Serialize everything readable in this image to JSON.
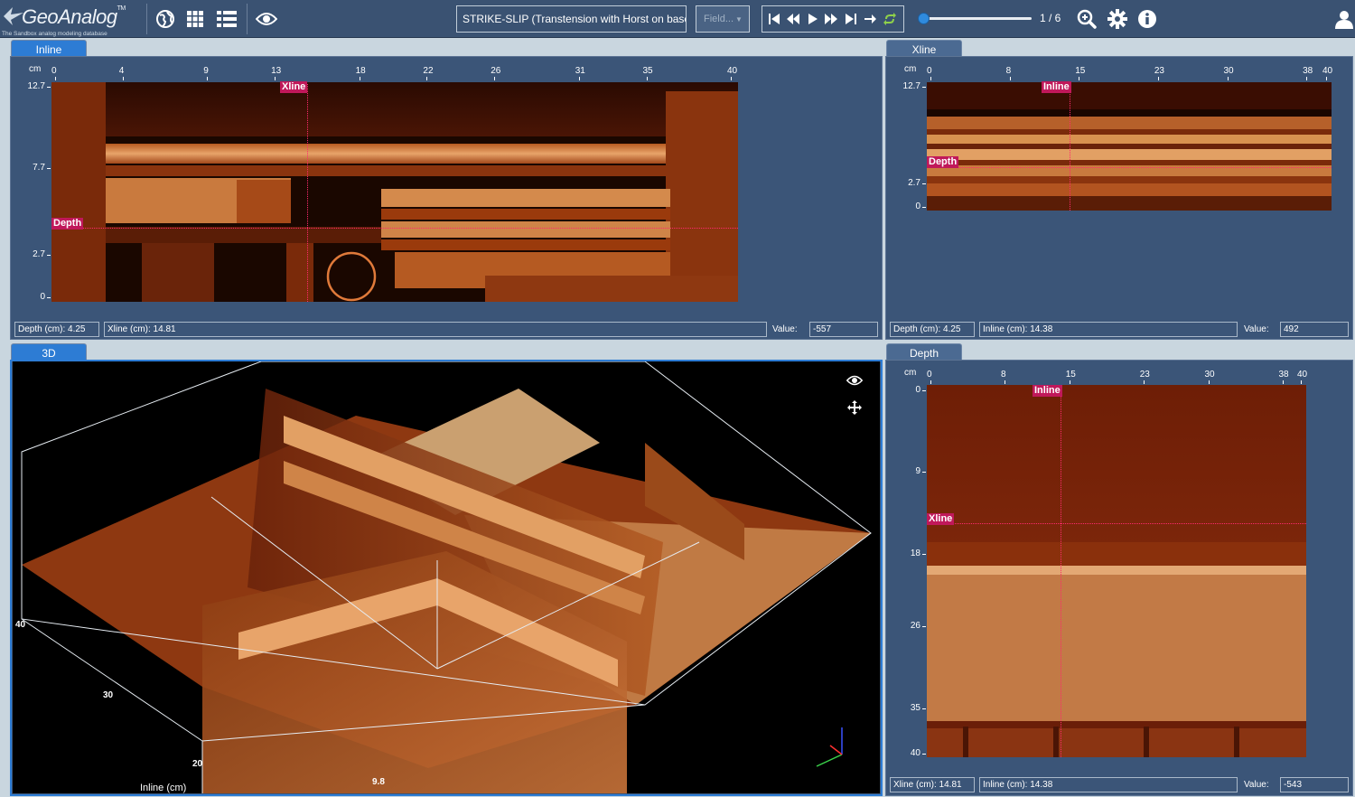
{
  "app": {
    "logo_text": "GeoAnalog",
    "logo_tm": "TM",
    "logo_subtitle": "The Sandbox analog modeling database",
    "model_title": "STRIKE-SLIP (Transtension with Horst on baseme",
    "field_placeholder": "Field...",
    "frame_counter": "1 / 6",
    "slider_fraction": 0.0
  },
  "inline_panel": {
    "tab": "Inline",
    "unit": "cm",
    "x_ticks": [
      "0",
      "4",
      "9",
      "13",
      "18",
      "22",
      "26",
      "31",
      "35",
      "40"
    ],
    "y_ticks": [
      "12.7",
      "7.7",
      "2.7",
      "0"
    ],
    "cross_v_label": "Xline",
    "cross_h_label": "Depth",
    "status_a": "Depth (cm): 4.25",
    "status_b": "Xline (cm): 14.81",
    "value_label": "Value:",
    "value": "-557"
  },
  "xline_panel": {
    "tab": "Xline",
    "unit": "cm",
    "x_ticks": [
      "0",
      "8",
      "15",
      "23",
      "30",
      "38",
      "40"
    ],
    "y_ticks": [
      "12.7",
      "2.7",
      "0"
    ],
    "cross_v_label": "Inline",
    "cross_h_label": "Depth",
    "status_a": "Depth (cm): 4.25",
    "status_b": "Inline (cm): 14.38",
    "value_label": "Value:",
    "value": "492"
  },
  "view3d_panel": {
    "tab": "3D",
    "axis_label": "Inline (cm)",
    "labels": [
      "40",
      "30",
      "20",
      "9.8"
    ]
  },
  "depth_panel": {
    "tab": "Depth",
    "unit": "cm",
    "x_ticks": [
      "0",
      "8",
      "15",
      "23",
      "30",
      "38",
      "40"
    ],
    "y_ticks": [
      "0",
      "9",
      "18",
      "26",
      "35",
      "40"
    ],
    "cross_v_label": "Inline",
    "cross_h_label": "Xline",
    "status_a": "Xline (cm): 14.81",
    "status_b": "Inline (cm): 14.38",
    "value_label": "Value:",
    "value": "-543"
  },
  "colors": {
    "topbar": "#3a5272",
    "panel": "#3b5578",
    "active_tab": "#2d7cd4",
    "crosshair": "#ff2a6d",
    "ct_dark": "#3a0d00",
    "ct_mid": "#9a3a0c",
    "ct_bright": "#e8a46a"
  },
  "icons": [
    "globe-icon",
    "grid-icon",
    "list-icon",
    "eye-icon",
    "zoom-icon",
    "gear-icon",
    "info-icon",
    "user-icon",
    "first-frame-icon",
    "rewind-icon",
    "play-icon",
    "fast-forward-icon",
    "last-frame-icon",
    "next-icon",
    "loop-icon",
    "move-icon"
  ]
}
